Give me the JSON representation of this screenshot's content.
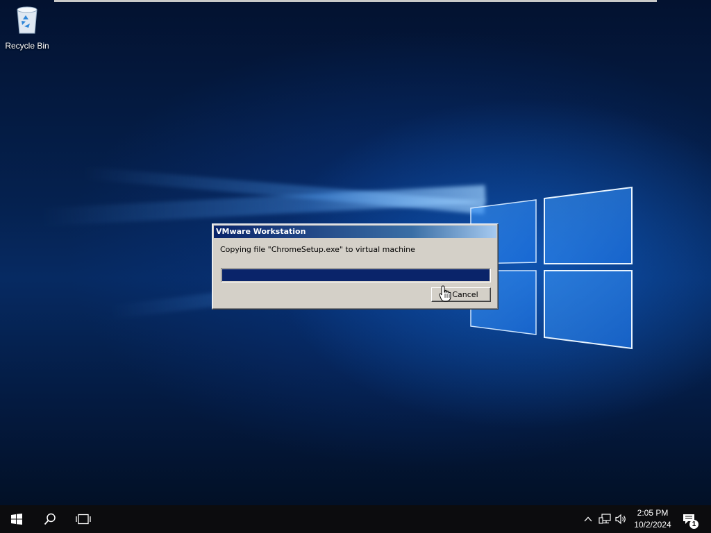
{
  "desktop": {
    "icons": [
      {
        "label": "Recycle Bin",
        "icon": "recycle-bin-icon"
      }
    ]
  },
  "dialog": {
    "title": "VMware Workstation",
    "message": "Copying file \"ChromeSetup.exe\" to virtual machine",
    "progress": 1.0,
    "cancel_label": "Cancel"
  },
  "taskbar": {
    "start_icon": "windows-start-icon",
    "search_icon": "search-icon",
    "task_view_icon": "task-view-icon",
    "tray": {
      "icons": [
        "chevron-up-icon",
        "network-icon",
        "volume-icon"
      ],
      "time": "2:05 PM",
      "date": "10/2/2024",
      "notification_count": "1"
    }
  },
  "colors": {
    "titlebar": "#0a246a",
    "dialog_bg": "#d4d0c8",
    "progress": "#0a246a",
    "taskbar": "#0c0c0e"
  }
}
